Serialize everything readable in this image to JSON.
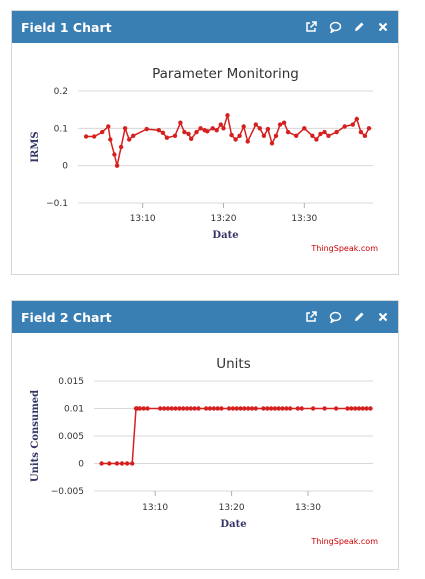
{
  "colors": {
    "header": "#3a7fb4",
    "series": "#d62020",
    "grid": "#d8d8d8",
    "credits": "#cc0000"
  },
  "icons": [
    "external-link-icon",
    "comment-icon",
    "pencil-icon",
    "close-icon"
  ],
  "widgets": [
    {
      "header_title": "Field 1 Chart",
      "credits": "ThingSpeak.com"
    },
    {
      "header_title": "Field 2 Chart",
      "credits": "ThingSpeak.com"
    }
  ],
  "chart_data": [
    {
      "type": "line",
      "title": "Parameter Monitoring",
      "xlabel": "Date",
      "ylabel": "IRMS",
      "ylim": [
        -0.1,
        0.2
      ],
      "yticks": [
        0.2,
        0.1,
        0,
        -0.1
      ],
      "ytick_labels": [
        "0.2",
        "0.1",
        "0",
        "−0.1"
      ],
      "xlim": [
        "13:02",
        "13:38.5"
      ],
      "xticks": [
        "13:10",
        "13:20",
        "13:30"
      ],
      "grid": true,
      "series": [
        {
          "x": [
            "13:03",
            "13:04",
            "13:05",
            "13:05:45",
            "13:06",
            "13:06:30",
            "13:06:50",
            "13:07:20",
            "13:07:50",
            "13:08:20",
            "13:08:50",
            "13:10:30",
            "13:12",
            "13:12:30",
            "13:13",
            "13:14",
            "13:14:40",
            "13:15:10",
            "13:15:40",
            "13:16",
            "13:16:40",
            "13:17:10",
            "13:17:40",
            "13:18",
            "13:18:40",
            "13:19:10",
            "13:19:40",
            "13:20",
            "13:20:30",
            "13:21",
            "13:21:30",
            "13:22",
            "13:22:30",
            "13:23",
            "13:24",
            "13:24:30",
            "13:25",
            "13:25:30",
            "13:26",
            "13:26:30",
            "13:27",
            "13:27:30",
            "13:28",
            "13:29",
            "13:30",
            "13:31",
            "13:31:30",
            "13:32",
            "13:32:30",
            "13:33",
            "13:34",
            "13:35",
            "13:36",
            "13:36:30",
            "13:37",
            "13:37:30",
            "13:38"
          ],
          "y": [
            0.078,
            0.078,
            0.09,
            0.105,
            0.07,
            0.03,
            0.0,
            0.05,
            0.1,
            0.07,
            0.08,
            0.098,
            0.095,
            0.088,
            0.075,
            0.08,
            0.115,
            0.09,
            0.085,
            0.072,
            0.09,
            0.1,
            0.095,
            0.092,
            0.1,
            0.095,
            0.11,
            0.1,
            0.135,
            0.082,
            0.07,
            0.08,
            0.105,
            0.065,
            0.11,
            0.1,
            0.08,
            0.098,
            0.06,
            0.08,
            0.11,
            0.115,
            0.09,
            0.08,
            0.1,
            0.08,
            0.07,
            0.085,
            0.09,
            0.08,
            0.09,
            0.105,
            0.11,
            0.125,
            0.09,
            0.08,
            0.1
          ]
        }
      ]
    },
    {
      "type": "line",
      "title": "Units",
      "xlabel": "Date",
      "ylabel": "Units Consumed",
      "ylim": [
        -0.005,
        0.015
      ],
      "yticks": [
        0.015,
        0.01,
        0.005,
        0,
        -0.005
      ],
      "ytick_labels": [
        "0.015",
        "0.01",
        "0.005",
        "0",
        "−0.005"
      ],
      "xlim": [
        "13:02",
        "13:38.5"
      ],
      "xticks": [
        "13:10",
        "13:20",
        "13:30"
      ],
      "grid": true,
      "series": [
        {
          "x": [
            "13:03",
            "13:04",
            "13:05",
            "13:05:40",
            "13:06:20",
            "13:07",
            "13:07:30",
            "13:07:40",
            "13:08",
            "13:08:30",
            "13:09",
            "13:10:40",
            "13:11:10",
            "13:11:40",
            "13:12:10",
            "13:12:40",
            "13:13:10",
            "13:13:40",
            "13:14:10",
            "13:14:40",
            "13:15:10",
            "13:15:40",
            "13:16:40",
            "13:17:10",
            "13:17:40",
            "13:18:10",
            "13:18:40",
            "13:19:40",
            "13:20:10",
            "13:20:40",
            "13:21:10",
            "13:21:40",
            "13:22:10",
            "13:22:40",
            "13:23:10",
            "13:24:10",
            "13:24:40",
            "13:25:10",
            "13:25:40",
            "13:26:10",
            "13:26:40",
            "13:27:10",
            "13:27:40",
            "13:28:40",
            "13:29:10",
            "13:30:40",
            "13:32:10",
            "13:33:40",
            "13:35:10",
            "13:35:40",
            "13:36:10",
            "13:36:40",
            "13:37:10",
            "13:37:40",
            "13:38:10"
          ],
          "y": [
            0,
            0,
            0,
            0,
            0,
            0,
            0.01,
            0.01,
            0.01,
            0.01,
            0.01,
            0.01,
            0.01,
            0.01,
            0.01,
            0.01,
            0.01,
            0.01,
            0.01,
            0.01,
            0.01,
            0.01,
            0.01,
            0.01,
            0.01,
            0.01,
            0.01,
            0.01,
            0.01,
            0.01,
            0.01,
            0.01,
            0.01,
            0.01,
            0.01,
            0.01,
            0.01,
            0.01,
            0.01,
            0.01,
            0.01,
            0.01,
            0.01,
            0.01,
            0.01,
            0.01,
            0.01,
            0.01,
            0.01,
            0.01,
            0.01,
            0.01,
            0.01,
            0.01,
            0.01
          ]
        }
      ]
    }
  ]
}
